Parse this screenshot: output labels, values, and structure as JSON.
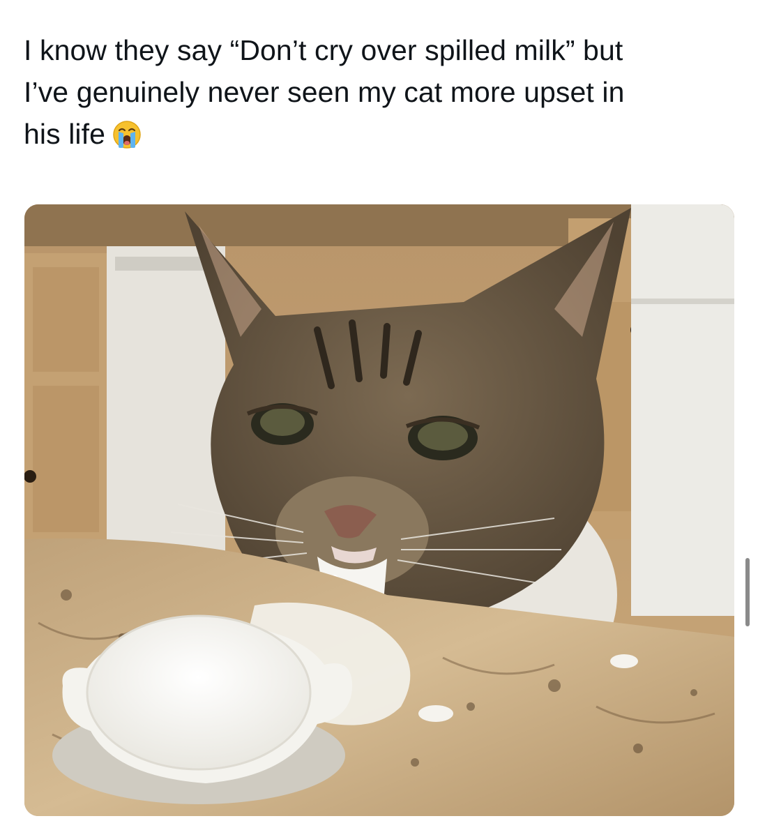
{
  "post": {
    "text_lines": [
      "I know they say “Don’t cry over spilled milk” but",
      "I’ve genuinely never seen my cat more upset in",
      "his life"
    ],
    "emoji": "loudly-crying-face-icon"
  },
  "media": {
    "icon": "photo-cat-spilled-milk",
    "colors": {
      "cabinet": "#c8a576",
      "fur": "#6b5a44",
      "countertop": "#c9ad84",
      "milk": "#f3f1ea"
    }
  },
  "scrollbar": {
    "color": "#8a8a8a"
  }
}
